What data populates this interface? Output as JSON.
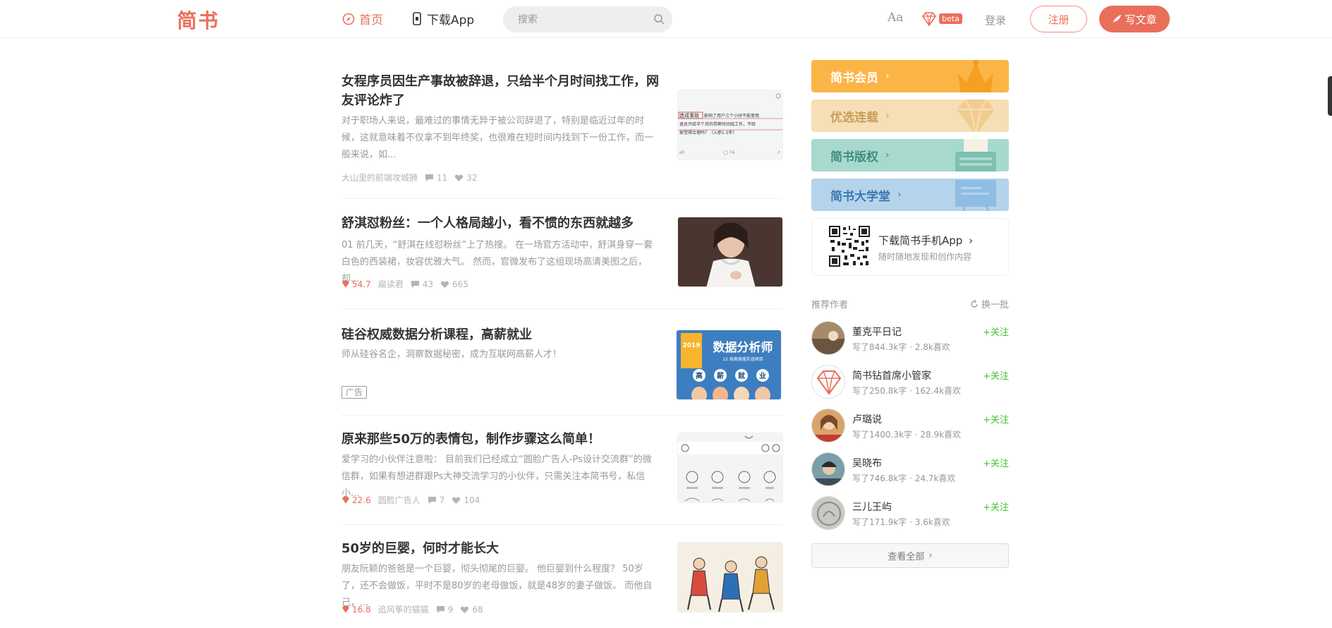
{
  "header": {
    "logo": "简书",
    "nav_home": "首页",
    "nav_app": "下载App",
    "search_placeholder": "搜索",
    "font_toggle": "Aa",
    "beta": "beta",
    "login": "登录",
    "register": "注册",
    "write": "写文章"
  },
  "articles": [
    {
      "title": "女程序员因生产事故被辞退，只给半个月时间找工作，网友评论炸了",
      "abstract": "对于职场人来说，最难过的事情无异于被公司辞退了，特别是临近过年的时候，这就意味着不仅拿不到年终奖，也很难在短时间内找到下一份工作，而一般来说，如...",
      "jewel": "",
      "author": "大山里的前端攻城狮",
      "comments": "11",
      "likes": "32",
      "thumb_text_1": "造成事故",
      "thumb_text_2": "影响了用户三个小时不能使用，退员只给半个月的带薪时间找工作，不给家觉得合理吗？（入职1.5年）"
    },
    {
      "title": "舒淇怼粉丝：一个人格局越小，看不惯的东西就越多",
      "abstract": "01 前几天，“舒淇在线怼粉丝”上了热搜。 在一场官方活动中，舒淇身穿一套白色的西装裙，妆容优雅大气。 然而，官微发布了这组现场高清美图之后，却...",
      "jewel": "54.7",
      "author": "扁读君",
      "comments": "43",
      "likes": "665"
    },
    {
      "title": "硅谷权威数据分析课程，高薪就业",
      "abstract": "师从硅谷名企，洞察数据秘密，成为互联网高薪人才！",
      "ad_tag": "广告",
      "ad_year": "2019",
      "ad_title": "数据分析师",
      "ad_sub": "12 周高强度实战项目",
      "ad_words": [
        "高",
        "薪",
        "就",
        "业"
      ]
    },
    {
      "title": "原来那些50万的表情包，制作步骤这么简单！",
      "abstract": "爱学习的小伙伴注意啦： 目前我们已经成立“圆脸广告人-Ps设计交流群”的微信群，如果有想进群跟Ps大神交流学习的小伙伴，只需关注本简书号，私信小...",
      "jewel": "22.6",
      "author": "圆脸广告人",
      "comments": "7",
      "likes": "104"
    },
    {
      "title": "50岁的巨婴，何时才能长大",
      "abstract": "朋友阮颖的爸爸是一个巨婴，彻头彻尾的巨婴。 他巨婴到什么程度？ 50岁了，还不会做饭，平时不是80岁的老母做饭，就是48岁的妻子做饭。 而他自己，...",
      "jewel": "16.8",
      "author": "追风筝的猫猫",
      "comments": "9",
      "likes": "68"
    }
  ],
  "sidebar": {
    "banners": [
      {
        "label": "简书会员",
        "color": "#fbb547"
      },
      {
        "label": "优选连载",
        "color": "#f6dfb5"
      },
      {
        "label": "简书版权",
        "color": "#a8d9cf"
      },
      {
        "label": "简书大学堂",
        "color": "#b5d4ec"
      }
    ],
    "download_title": "下载简书手机App",
    "download_sub": "随时随地发现和创作内容",
    "rec_title": "推荐作者",
    "rec_swap": "换一批",
    "authors": [
      {
        "name": "董克平日记",
        "stats": "写了844.3k字 · 2.8k喜欢",
        "follow": "+关注"
      },
      {
        "name": "简书钻首席小管家",
        "stats": "写了250.8k字 · 162.4k喜欢",
        "follow": "+关注"
      },
      {
        "name": "卢璐说",
        "stats": "写了1400.3k字 · 28.9k喜欢",
        "follow": "+关注"
      },
      {
        "name": "吴晓布",
        "stats": "写了746.8k字 · 24.7k喜欢",
        "follow": "+关注"
      },
      {
        "name": "三儿王屿",
        "stats": "写了171.9k字 · 3.6k喜欢",
        "follow": "+关注"
      }
    ],
    "see_all": "查看全部"
  }
}
